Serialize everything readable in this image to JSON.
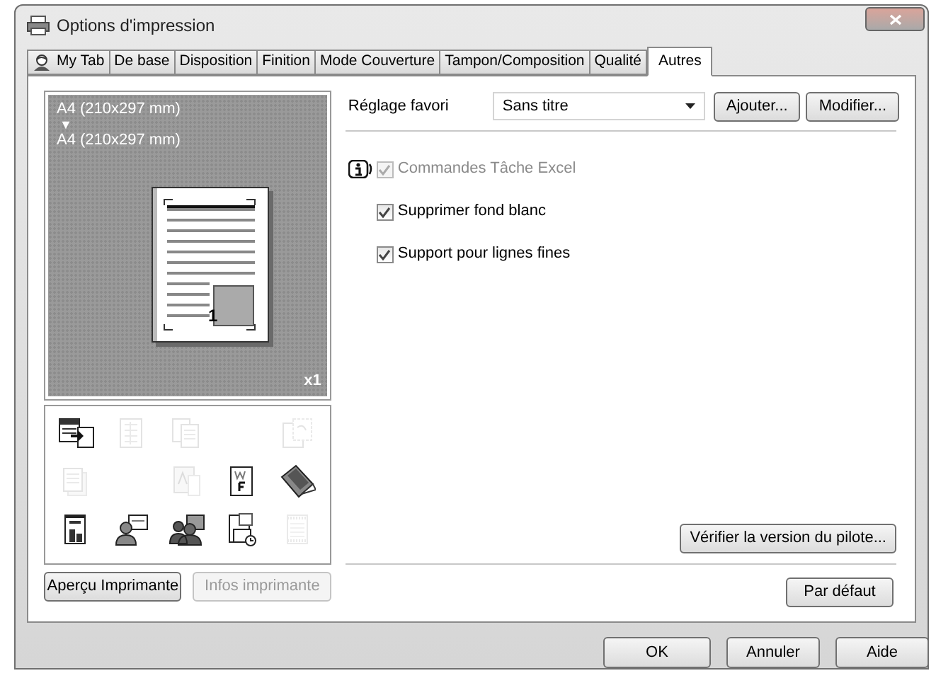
{
  "window": {
    "title": "Options d'impression"
  },
  "tabs": [
    {
      "label": "My Tab",
      "kind": "person",
      "selected": false
    },
    {
      "label": "De base",
      "kind": "plain",
      "selected": false
    },
    {
      "label": "Disposition",
      "kind": "plain",
      "selected": false
    },
    {
      "label": "Finition",
      "kind": "plain",
      "selected": false
    },
    {
      "label": "Mode Couverture",
      "kind": "plain",
      "selected": false
    },
    {
      "label": "Tampon/Composition",
      "kind": "plain",
      "selected": false
    },
    {
      "label": "Qualité",
      "kind": "plain",
      "selected": false
    },
    {
      "label": "Autres",
      "kind": "plain",
      "selected": true
    }
  ],
  "preview": {
    "paper_from": "A4 (210x297 mm)",
    "arrow": "▼",
    "paper_to": "A4 (210x297 mm)",
    "page_number": "1",
    "copies": "x1"
  },
  "function_icons": [
    {
      "kind": "doc-arrow",
      "disabled": false
    },
    {
      "kind": "grid-page",
      "disabled": true
    },
    {
      "kind": "copies",
      "disabled": true
    },
    {
      "kind": "empty"
    },
    {
      "kind": "rotate",
      "disabled": true
    },
    {
      "kind": "stack",
      "disabled": true
    },
    {
      "kind": "empty"
    },
    {
      "kind": "text-page",
      "disabled": true
    },
    {
      "kind": "wf-page",
      "disabled": false
    },
    {
      "kind": "tilted-pages",
      "disabled": false
    },
    {
      "kind": "report",
      "disabled": false
    },
    {
      "kind": "person-screen",
      "disabled": false
    },
    {
      "kind": "people-screen",
      "disabled": false
    },
    {
      "kind": "page-clock",
      "disabled": false
    },
    {
      "kind": "strip-page",
      "disabled": true
    }
  ],
  "left_buttons": [
    {
      "label": "Aperçu Imprimante",
      "disabled": false
    },
    {
      "label": "Infos imprimante",
      "disabled": true
    }
  ],
  "favorite": {
    "label": "Réglage favori",
    "value": "Sans titre",
    "buttons": [
      "Ajouter...",
      "Modifier..."
    ]
  },
  "options": [
    {
      "label": "Commandes Tâche Excel",
      "checked": true,
      "disabled": true,
      "info": true
    },
    {
      "label": "Supprimer fond blanc",
      "checked": true,
      "disabled": false,
      "info": false
    },
    {
      "label": "Support pour lignes fines",
      "checked": true,
      "disabled": false,
      "info": false
    }
  ],
  "driver_button": "Vérifier la version du pilote...",
  "default_button": "Par défaut",
  "dialog_buttons": [
    "OK",
    "Annuler",
    "Aide"
  ]
}
